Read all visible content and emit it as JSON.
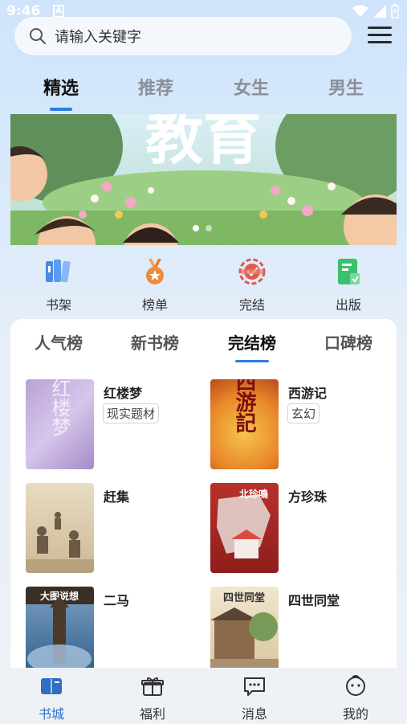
{
  "status_bar": {
    "time": "9:46",
    "a_badge": "A"
  },
  "search": {
    "placeholder": "请输入关键字"
  },
  "tabs": [
    {
      "label": "精选",
      "active": true
    },
    {
      "label": "推荐",
      "active": false
    },
    {
      "label": "女生",
      "active": false
    },
    {
      "label": "男生",
      "active": false
    }
  ],
  "banner": {
    "headline": "教育",
    "slide_count": 2,
    "active_slide": 1
  },
  "quick_nav": [
    {
      "label": "书架",
      "icon": "bookshelf-icon",
      "color": "#4a8be8"
    },
    {
      "label": "榜单",
      "icon": "medal-icon",
      "color": "#f08a3c"
    },
    {
      "label": "完结",
      "icon": "completed-badge-icon",
      "color": "#e05a4a"
    },
    {
      "label": "出版",
      "icon": "publish-book-icon",
      "color": "#3cbf6e"
    }
  ],
  "ranking": {
    "tabs": [
      {
        "label": "人气榜",
        "active": false
      },
      {
        "label": "新书榜",
        "active": false
      },
      {
        "label": "完结榜",
        "active": true
      },
      {
        "label": "口碑榜",
        "active": false
      }
    ],
    "books": [
      {
        "title": "红楼梦",
        "tag": "现实题材",
        "cover_text": "红楼梦"
      },
      {
        "title": "西游记",
        "tag": "玄幻",
        "cover_text": "西游記"
      },
      {
        "title": "赶集",
        "tag": "",
        "cover_text": ""
      },
      {
        "title": "方珍珠",
        "tag": "",
        "cover_text": "北珍鳴"
      },
      {
        "title": "二马",
        "tag": "",
        "cover_text": "大图说想"
      },
      {
        "title": "四世同堂",
        "tag": "",
        "cover_text": "四世同堂"
      }
    ]
  },
  "bottom_nav": [
    {
      "label": "书城",
      "icon": "book-city-icon",
      "active": true
    },
    {
      "label": "福利",
      "icon": "gift-icon",
      "active": false
    },
    {
      "label": "消息",
      "icon": "message-icon",
      "active": false
    },
    {
      "label": "我的",
      "icon": "profile-icon",
      "active": false
    }
  ],
  "colors": {
    "accent": "#2f7de1",
    "active_nav": "#2f6fc6"
  }
}
